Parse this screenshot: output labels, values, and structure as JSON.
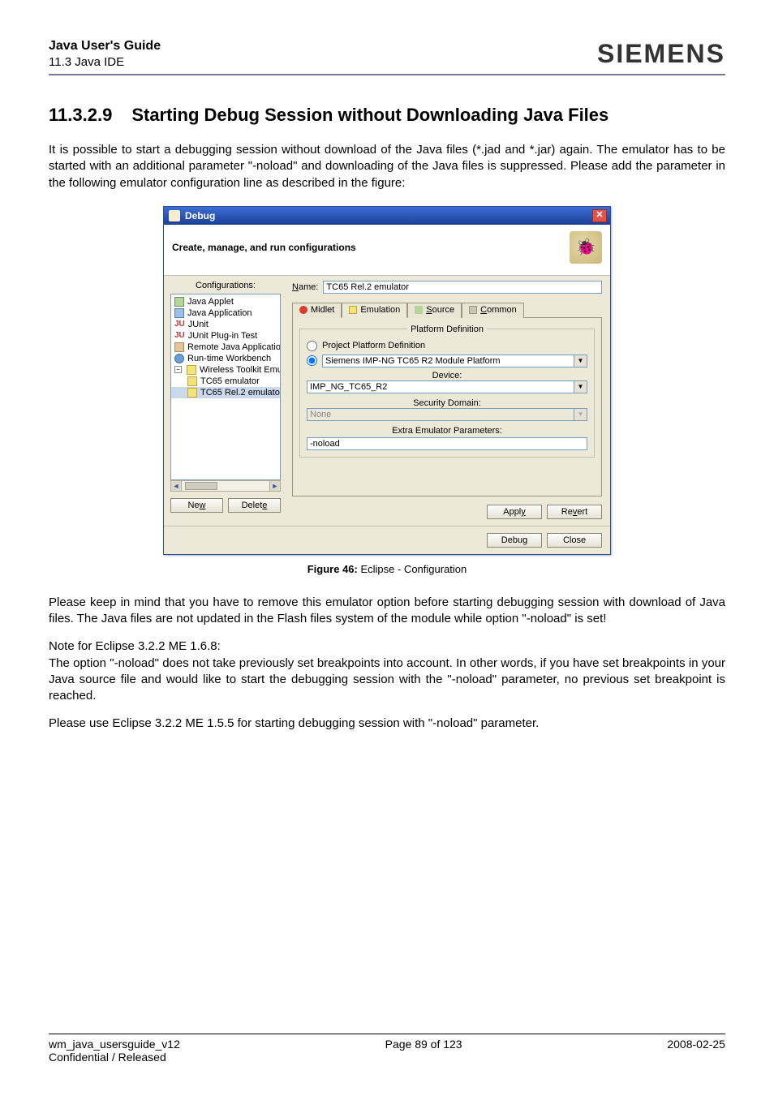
{
  "header": {
    "doc_title": "Java User's Guide",
    "section": "11.3 Java IDE",
    "brand": "SIEMENS"
  },
  "heading": {
    "number": "11.3.2.9",
    "title": "Starting Debug Session without Downloading Java Files"
  },
  "para1": "It is possible to start a debugging session without download of the Java files (*.jad and *.jar) again. The emulator has to be started with an additional parameter \"-noload\" and downloading of the Java files is suppressed. Please add the parameter in the following emulator configuration line as described in the figure:",
  "dialog": {
    "title": "Debug",
    "banner": "Create, manage, and run configurations",
    "configurations_label": "Configurations:",
    "tree": {
      "items": [
        {
          "label": "Java Applet"
        },
        {
          "label": "Java Application"
        },
        {
          "label": "JUnit"
        },
        {
          "label": "JUnit Plug-in Test"
        },
        {
          "label": "Remote Java Applicatio"
        },
        {
          "label": "Run-time Workbench"
        },
        {
          "label": "Wireless Toolkit Emulato"
        },
        {
          "label": "TC65 emulator"
        },
        {
          "label": "TC65 Rel.2 emulato"
        }
      ]
    },
    "new_btn": "New",
    "delete_btn": "Delete",
    "name_label": "Name:",
    "name_value": "TC65 Rel.2 emulator",
    "tabs": {
      "midlet": "Midlet",
      "emulation": "Emulation",
      "source": "Source",
      "common": "Common"
    },
    "platform_definition": {
      "legend": "Platform Definition",
      "project_radio": "Project Platform Definition",
      "specific_value": "Siemens IMP-NG TC65 R2 Module Platform",
      "device_label": "Device:",
      "device_value": "IMP_NG_TC65_R2",
      "security_label": "Security Domain:",
      "security_value": "None",
      "extra_label": "Extra Emulator Parameters:",
      "extra_value": "-noload"
    },
    "apply_btn": "Apply",
    "revert_btn": "Revert",
    "debug_btn": "Debug",
    "close_btn": "Close"
  },
  "figure_caption": {
    "bold": "Figure 46:",
    "rest": "  Eclipse - Configuration"
  },
  "para2": "Please keep in mind that you have to remove this emulator option before starting debugging session with download of Java files. The Java files are not updated in the Flash files system of the module while option \"-noload\" is set!",
  "note_heading": "Note for Eclipse 3.2.2 ME 1.6.8:",
  "para3": "The option \"-noload\" does not take previously set breakpoints into account. In other words, if you have set breakpoints in your Java source file and would like to start the debugging session with the \"-noload\" parameter, no previous set breakpoint is reached.",
  "para4": "Please use Eclipse 3.2.2 ME 1.5.5 for starting debugging session with \"-noload\" parameter.",
  "footer": {
    "left1": "wm_java_usersguide_v12",
    "left2": "Confidential / Released",
    "center": "Page 89 of 123",
    "right": "2008-02-25"
  }
}
